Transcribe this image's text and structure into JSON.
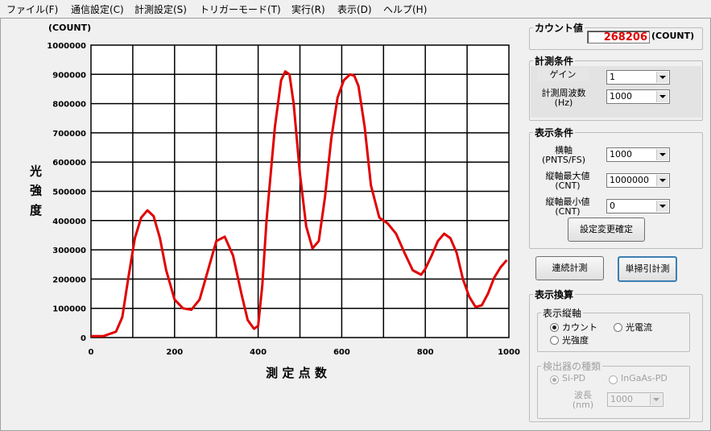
{
  "menu": [
    "ファイル(F)",
    "通信設定(C)",
    "計測設定(S)",
    "トリガーモード(T)",
    "実行(R)",
    "表示(D)",
    "ヘルプ(H)"
  ],
  "chart_unit_label": "(COUNT)",
  "chart_data": {
    "type": "line",
    "ylabel": "光 強 度",
    "xlabel": "測 定 点 数",
    "xlim": [
      0,
      1000
    ],
    "ylim": [
      0,
      1000000
    ],
    "x_ticks": [
      "0",
      "200",
      "400",
      "600",
      "800",
      "1000"
    ],
    "y_ticks": [
      "0",
      "100000",
      "200000",
      "300000",
      "400000",
      "500000",
      "600000",
      "700000",
      "800000",
      "900000",
      "1000000"
    ],
    "grid": true,
    "line_color": "#e00000",
    "series": [
      {
        "x": [
          0,
          30,
          60,
          75,
          90,
          105,
          120,
          135,
          150,
          165,
          180,
          200,
          220,
          240,
          260,
          280,
          300,
          320,
          340,
          360,
          375,
          390,
          400,
          410,
          420,
          440,
          455,
          465,
          475,
          485,
          500,
          515,
          530,
          545,
          560,
          575,
          590,
          605,
          620,
          630,
          640,
          655,
          670,
          690,
          710,
          730,
          750,
          770,
          790,
          800,
          815,
          830,
          845,
          860,
          875,
          890,
          905,
          920,
          935,
          950,
          965,
          980,
          995
        ],
        "y": [
          5000,
          5000,
          20000,
          70000,
          210000,
          340000,
          410000,
          435000,
          415000,
          340000,
          230000,
          130000,
          100000,
          95000,
          130000,
          230000,
          330000,
          345000,
          280000,
          150000,
          60000,
          30000,
          40000,
          180000,
          400000,
          720000,
          880000,
          910000,
          900000,
          800000,
          560000,
          380000,
          305000,
          330000,
          480000,
          680000,
          820000,
          880000,
          900000,
          895000,
          860000,
          720000,
          520000,
          410000,
          390000,
          355000,
          290000,
          230000,
          215000,
          235000,
          280000,
          330000,
          355000,
          340000,
          290000,
          200000,
          140000,
          105000,
          110000,
          150000,
          205000,
          240000,
          265000
        ]
      }
    ]
  },
  "count": {
    "title": "カウント値",
    "value": "268206",
    "unit": "(COUNT)"
  },
  "measurement": {
    "title": "計測条件",
    "gain_label": "ゲイン",
    "gain_value": "1",
    "freq_label": "計測周波数\n(Hz)",
    "freq_value": "1000"
  },
  "display": {
    "title": "表示条件",
    "xaxis_label": "横軸\n(PNTS/FS)",
    "xaxis_value": "1000",
    "ymax_label": "縦軸最大値\n(CNT)",
    "ymax_value": "1000000",
    "ymin_label": "縦軸最小値\n(CNT)",
    "ymin_value": "0",
    "apply_button": "設定変更確定"
  },
  "buttons": {
    "continuous": "連続計測",
    "single": "単掃引計測"
  },
  "conversion": {
    "title": "表示換算",
    "axis_group": "表示縦軸",
    "opt_count": "カウント",
    "opt_current": "光電流",
    "opt_intensity": "光強度",
    "detector_group": "検出器の種類",
    "det_si": "Si-PD",
    "det_ingaas": "InGaAs-PD",
    "wavelength_label": "波長\n(nm)",
    "wavelength_value": "1000"
  }
}
